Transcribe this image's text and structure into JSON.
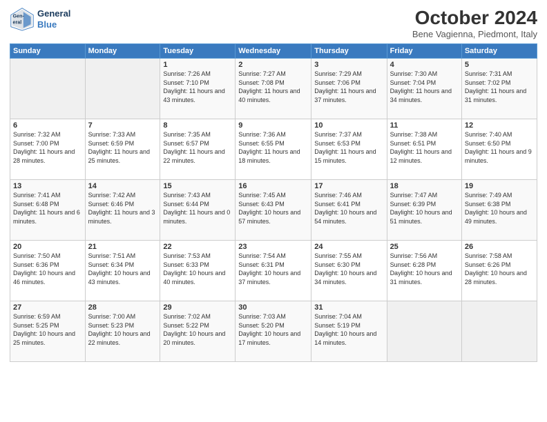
{
  "header": {
    "logo_line1": "General",
    "logo_line2": "Blue",
    "title": "October 2024",
    "subtitle": "Bene Vagienna, Piedmont, Italy"
  },
  "weekdays": [
    "Sunday",
    "Monday",
    "Tuesday",
    "Wednesday",
    "Thursday",
    "Friday",
    "Saturday"
  ],
  "weeks": [
    [
      {
        "day": "",
        "info": ""
      },
      {
        "day": "",
        "info": ""
      },
      {
        "day": "1",
        "info": "Sunrise: 7:26 AM\nSunset: 7:10 PM\nDaylight: 11 hours and 43 minutes."
      },
      {
        "day": "2",
        "info": "Sunrise: 7:27 AM\nSunset: 7:08 PM\nDaylight: 11 hours and 40 minutes."
      },
      {
        "day": "3",
        "info": "Sunrise: 7:29 AM\nSunset: 7:06 PM\nDaylight: 11 hours and 37 minutes."
      },
      {
        "day": "4",
        "info": "Sunrise: 7:30 AM\nSunset: 7:04 PM\nDaylight: 11 hours and 34 minutes."
      },
      {
        "day": "5",
        "info": "Sunrise: 7:31 AM\nSunset: 7:02 PM\nDaylight: 11 hours and 31 minutes."
      }
    ],
    [
      {
        "day": "6",
        "info": "Sunrise: 7:32 AM\nSunset: 7:00 PM\nDaylight: 11 hours and 28 minutes."
      },
      {
        "day": "7",
        "info": "Sunrise: 7:33 AM\nSunset: 6:59 PM\nDaylight: 11 hours and 25 minutes."
      },
      {
        "day": "8",
        "info": "Sunrise: 7:35 AM\nSunset: 6:57 PM\nDaylight: 11 hours and 22 minutes."
      },
      {
        "day": "9",
        "info": "Sunrise: 7:36 AM\nSunset: 6:55 PM\nDaylight: 11 hours and 18 minutes."
      },
      {
        "day": "10",
        "info": "Sunrise: 7:37 AM\nSunset: 6:53 PM\nDaylight: 11 hours and 15 minutes."
      },
      {
        "day": "11",
        "info": "Sunrise: 7:38 AM\nSunset: 6:51 PM\nDaylight: 11 hours and 12 minutes."
      },
      {
        "day": "12",
        "info": "Sunrise: 7:40 AM\nSunset: 6:50 PM\nDaylight: 11 hours and 9 minutes."
      }
    ],
    [
      {
        "day": "13",
        "info": "Sunrise: 7:41 AM\nSunset: 6:48 PM\nDaylight: 11 hours and 6 minutes."
      },
      {
        "day": "14",
        "info": "Sunrise: 7:42 AM\nSunset: 6:46 PM\nDaylight: 11 hours and 3 minutes."
      },
      {
        "day": "15",
        "info": "Sunrise: 7:43 AM\nSunset: 6:44 PM\nDaylight: 11 hours and 0 minutes."
      },
      {
        "day": "16",
        "info": "Sunrise: 7:45 AM\nSunset: 6:43 PM\nDaylight: 10 hours and 57 minutes."
      },
      {
        "day": "17",
        "info": "Sunrise: 7:46 AM\nSunset: 6:41 PM\nDaylight: 10 hours and 54 minutes."
      },
      {
        "day": "18",
        "info": "Sunrise: 7:47 AM\nSunset: 6:39 PM\nDaylight: 10 hours and 51 minutes."
      },
      {
        "day": "19",
        "info": "Sunrise: 7:49 AM\nSunset: 6:38 PM\nDaylight: 10 hours and 49 minutes."
      }
    ],
    [
      {
        "day": "20",
        "info": "Sunrise: 7:50 AM\nSunset: 6:36 PM\nDaylight: 10 hours and 46 minutes."
      },
      {
        "day": "21",
        "info": "Sunrise: 7:51 AM\nSunset: 6:34 PM\nDaylight: 10 hours and 43 minutes."
      },
      {
        "day": "22",
        "info": "Sunrise: 7:53 AM\nSunset: 6:33 PM\nDaylight: 10 hours and 40 minutes."
      },
      {
        "day": "23",
        "info": "Sunrise: 7:54 AM\nSunset: 6:31 PM\nDaylight: 10 hours and 37 minutes."
      },
      {
        "day": "24",
        "info": "Sunrise: 7:55 AM\nSunset: 6:30 PM\nDaylight: 10 hours and 34 minutes."
      },
      {
        "day": "25",
        "info": "Sunrise: 7:56 AM\nSunset: 6:28 PM\nDaylight: 10 hours and 31 minutes."
      },
      {
        "day": "26",
        "info": "Sunrise: 7:58 AM\nSunset: 6:26 PM\nDaylight: 10 hours and 28 minutes."
      }
    ],
    [
      {
        "day": "27",
        "info": "Sunrise: 6:59 AM\nSunset: 5:25 PM\nDaylight: 10 hours and 25 minutes."
      },
      {
        "day": "28",
        "info": "Sunrise: 7:00 AM\nSunset: 5:23 PM\nDaylight: 10 hours and 22 minutes."
      },
      {
        "day": "29",
        "info": "Sunrise: 7:02 AM\nSunset: 5:22 PM\nDaylight: 10 hours and 20 minutes."
      },
      {
        "day": "30",
        "info": "Sunrise: 7:03 AM\nSunset: 5:20 PM\nDaylight: 10 hours and 17 minutes."
      },
      {
        "day": "31",
        "info": "Sunrise: 7:04 AM\nSunset: 5:19 PM\nDaylight: 10 hours and 14 minutes."
      },
      {
        "day": "",
        "info": ""
      },
      {
        "day": "",
        "info": ""
      }
    ]
  ]
}
